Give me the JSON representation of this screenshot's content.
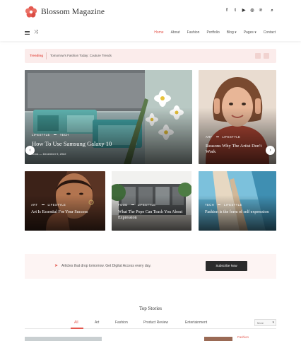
{
  "header": {
    "logo_text": "Blossom Magazine",
    "socials": [
      "f",
      "t",
      "▶",
      "◎",
      "℗",
      "⌕"
    ],
    "social_names": [
      "facebook-icon",
      "twitter-icon",
      "youtube-icon",
      "instagram-icon",
      "pinterest-icon",
      "search-icon"
    ],
    "nav": [
      {
        "label": "Home",
        "active": true
      },
      {
        "label": "About",
        "active": false
      },
      {
        "label": "Fashion",
        "active": false
      },
      {
        "label": "Portfolio",
        "active": false
      },
      {
        "label": "Blog ▾",
        "active": false
      },
      {
        "label": "Pages ▾",
        "active": false
      },
      {
        "label": "Contact",
        "active": false
      }
    ]
  },
  "ticker": {
    "label": "Trending",
    "text": "Tomorrow's Fashion Today: Couture Trends"
  },
  "slider": {
    "main": {
      "categories": [
        "LIFESTYLE",
        "TECH"
      ],
      "title": "How To Use Samsung Galaxy 10",
      "author": "Anna",
      "date": "December 9, 2022"
    },
    "side": {
      "categories": [
        "ART",
        "LIFESTYLE"
      ],
      "title": "Reasons Why The Artist Don't Work"
    }
  },
  "cards": [
    {
      "categories": [
        "ART",
        "LIFESTYLE"
      ],
      "title": "Art Is Essential For Your Success"
    },
    {
      "categories": [
        "FOOD",
        "LIFESTYLE"
      ],
      "title": "What The Pope Can Teach You About Expression"
    },
    {
      "categories": [
        "TECH",
        "LIFESTYLE"
      ],
      "title": "Fashion is the form of self expression"
    }
  ],
  "subscribe": {
    "text": "Articles that drop tomorrow. Get Digital Access every day.",
    "button": "Subscribe Now"
  },
  "top_stories": {
    "title": "Top Stories",
    "tabs": [
      "All",
      "Art",
      "Fashion",
      "Product Review",
      "Entertainment"
    ],
    "active_tab": "All",
    "select_value": "More",
    "side_category": "Fashion"
  },
  "colors": {
    "accent": "#e4584f",
    "ticker_bg": "#fbeceb",
    "subscribe_bg": "#fdf4f3",
    "button_bg": "#2b2b2b"
  }
}
